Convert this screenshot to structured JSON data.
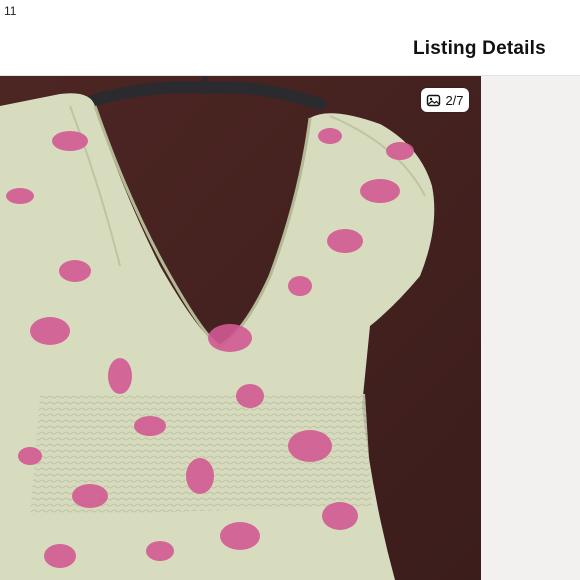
{
  "status_bar": {
    "time": "11"
  },
  "header": {
    "title": "Listing Details"
  },
  "gallery": {
    "counter": "2/7",
    "counter_icon": "photos-icon",
    "colors": {
      "background_wall": "#4a2522",
      "dress_base": "#d8dcbf",
      "floral_print": "#d25a93",
      "hanger": "#2b2a2e",
      "next_panel": "#f3f1ef"
    }
  }
}
